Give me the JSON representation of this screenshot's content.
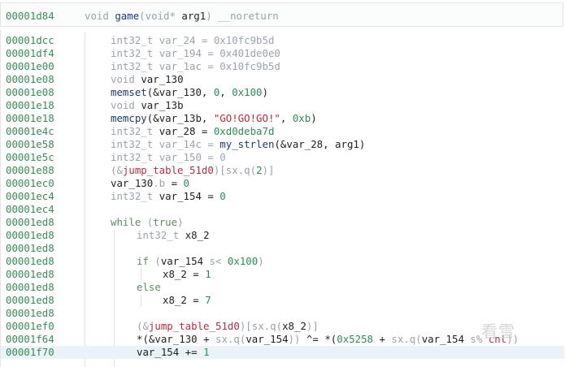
{
  "header": {
    "address": "00001d84",
    "tokens": [
      {
        "t": "void ",
        "c": "type"
      },
      {
        "t": "game",
        "c": "fn"
      },
      {
        "t": "(",
        "c": "sym"
      },
      {
        "t": "void* ",
        "c": "type"
      },
      {
        "t": "arg1",
        "c": "var"
      },
      {
        "t": ") ",
        "c": "sym"
      },
      {
        "t": "__noreturn",
        "c": "type"
      }
    ]
  },
  "lines": [
    {
      "addr": "00001dcc",
      "indent": 1,
      "tokens": [
        {
          "t": "int32_t ",
          "c": "type"
        },
        {
          "t": "var_24",
          "c": "type"
        },
        {
          "t": " = ",
          "c": "type"
        },
        {
          "t": "0x10fc9b5d",
          "c": "type"
        }
      ]
    },
    {
      "addr": "00001df4",
      "indent": 1,
      "tokens": [
        {
          "t": "int32_t ",
          "c": "type"
        },
        {
          "t": "var_194",
          "c": "type"
        },
        {
          "t": " = ",
          "c": "type"
        },
        {
          "t": "0x401de0e0",
          "c": "type"
        }
      ]
    },
    {
      "addr": "00001e00",
      "indent": 1,
      "tokens": [
        {
          "t": "int32_t ",
          "c": "type"
        },
        {
          "t": "var_1ac",
          "c": "type"
        },
        {
          "t": " = ",
          "c": "type"
        },
        {
          "t": "0x10fc9b5d",
          "c": "type"
        }
      ]
    },
    {
      "addr": "00001e08",
      "indent": 1,
      "tokens": [
        {
          "t": "void ",
          "c": "type"
        },
        {
          "t": "var_130",
          "c": "var"
        }
      ]
    },
    {
      "addr": "00001e08",
      "indent": 1,
      "tokens": [
        {
          "t": "memset",
          "c": "fn"
        },
        {
          "t": "(&",
          "c": "dark"
        },
        {
          "t": "var_130",
          "c": "var"
        },
        {
          "t": ", ",
          "c": "dark"
        },
        {
          "t": "0",
          "c": "num"
        },
        {
          "t": ", ",
          "c": "dark"
        },
        {
          "t": "0x100",
          "c": "num"
        },
        {
          "t": ")",
          "c": "dark"
        }
      ]
    },
    {
      "addr": "00001e18",
      "indent": 1,
      "tokens": [
        {
          "t": "void ",
          "c": "type"
        },
        {
          "t": "var_13b",
          "c": "var"
        }
      ]
    },
    {
      "addr": "00001e18",
      "indent": 1,
      "tokens": [
        {
          "t": "memcpy",
          "c": "fn"
        },
        {
          "t": "(&",
          "c": "dark"
        },
        {
          "t": "var_13b",
          "c": "var"
        },
        {
          "t": ", ",
          "c": "dark"
        },
        {
          "t": "\"GO!GO!GO!\"",
          "c": "str"
        },
        {
          "t": ", ",
          "c": "dark"
        },
        {
          "t": "0xb",
          "c": "num"
        },
        {
          "t": ")",
          "c": "dark"
        }
      ]
    },
    {
      "addr": "00001e4c",
      "indent": 1,
      "tokens": [
        {
          "t": "int32_t ",
          "c": "type"
        },
        {
          "t": "var_28",
          "c": "var"
        },
        {
          "t": " = ",
          "c": "dark"
        },
        {
          "t": "0xd0deba7d",
          "c": "num"
        }
      ]
    },
    {
      "addr": "00001e58",
      "indent": 1,
      "tokens": [
        {
          "t": "int32_t ",
          "c": "type"
        },
        {
          "t": "var_14c",
          "c": "type"
        },
        {
          "t": " = ",
          "c": "type"
        },
        {
          "t": "my_strlen",
          "c": "fn"
        },
        {
          "t": "(&",
          "c": "dark"
        },
        {
          "t": "var_28",
          "c": "var"
        },
        {
          "t": ", ",
          "c": "dark"
        },
        {
          "t": "arg1",
          "c": "var"
        },
        {
          "t": ")",
          "c": "dark"
        }
      ]
    },
    {
      "addr": "00001e5c",
      "indent": 1,
      "tokens": [
        {
          "t": "int32_t ",
          "c": "type"
        },
        {
          "t": "var_150",
          "c": "type"
        },
        {
          "t": " = ",
          "c": "type"
        },
        {
          "t": "0",
          "c": "type"
        }
      ]
    },
    {
      "addr": "00001e88",
      "indent": 1,
      "tokens": [
        {
          "t": "(&",
          "c": "sym"
        },
        {
          "t": "jump_table_51d0",
          "c": "jt"
        },
        {
          "t": ")",
          "c": "sym"
        },
        {
          "t": "[",
          "c": "sym"
        },
        {
          "t": "sx.q",
          "c": "mod"
        },
        {
          "t": "(",
          "c": "sym"
        },
        {
          "t": "2",
          "c": "num"
        },
        {
          "t": ")]",
          "c": "sym"
        }
      ]
    },
    {
      "addr": "00001ec0",
      "indent": 1,
      "tokens": [
        {
          "t": "var_130",
          "c": "var"
        },
        {
          "t": ".b",
          "c": "mod"
        },
        {
          "t": " = ",
          "c": "dark"
        },
        {
          "t": "0",
          "c": "num"
        }
      ]
    },
    {
      "addr": "00001ec4",
      "indent": 1,
      "tokens": [
        {
          "t": "int32_t ",
          "c": "type"
        },
        {
          "t": "var_154",
          "c": "var"
        },
        {
          "t": " = ",
          "c": "dark"
        },
        {
          "t": "0",
          "c": "num"
        }
      ]
    },
    {
      "addr": "00001ec4",
      "indent": 1,
      "tokens": []
    },
    {
      "addr": "00001ed8",
      "indent": 1,
      "tokens": [
        {
          "t": "while",
          "c": "kw"
        },
        {
          "t": " (",
          "c": "sym"
        },
        {
          "t": "true",
          "c": "kw"
        },
        {
          "t": ")",
          "c": "sym"
        }
      ]
    },
    {
      "addr": "00001ed8",
      "indent": 2,
      "tokens": [
        {
          "t": "int32_t ",
          "c": "type"
        },
        {
          "t": "x8_2",
          "c": "var"
        }
      ]
    },
    {
      "addr": "00001ed8",
      "indent": 2,
      "tokens": []
    },
    {
      "addr": "00001ed8",
      "indent": 2,
      "tokens": [
        {
          "t": "if",
          "c": "kw"
        },
        {
          "t": " (",
          "c": "sym"
        },
        {
          "t": "var_154",
          "c": "var"
        },
        {
          "t": " s< ",
          "c": "mod"
        },
        {
          "t": "0x100",
          "c": "num"
        },
        {
          "t": ")",
          "c": "sym"
        }
      ]
    },
    {
      "addr": "00001ed8",
      "indent": 3,
      "tokens": [
        {
          "t": "x8_2",
          "c": "var"
        },
        {
          "t": " = ",
          "c": "dark"
        },
        {
          "t": "1",
          "c": "num"
        }
      ]
    },
    {
      "addr": "00001ed8",
      "indent": 2,
      "tokens": [
        {
          "t": "else",
          "c": "kw"
        }
      ]
    },
    {
      "addr": "00001ed8",
      "indent": 3,
      "tokens": [
        {
          "t": "x8_2",
          "c": "var"
        },
        {
          "t": " = ",
          "c": "dark"
        },
        {
          "t": "7",
          "c": "num"
        }
      ]
    },
    {
      "addr": "00001ed8",
      "indent": 2,
      "tokens": []
    },
    {
      "addr": "00001ef0",
      "indent": 2,
      "tokens": [
        {
          "t": "(&",
          "c": "sym"
        },
        {
          "t": "jump_table_51d0",
          "c": "jt"
        },
        {
          "t": ")",
          "c": "sym"
        },
        {
          "t": "[",
          "c": "sym"
        },
        {
          "t": "sx.q",
          "c": "mod"
        },
        {
          "t": "(",
          "c": "sym"
        },
        {
          "t": "x8_2",
          "c": "var"
        },
        {
          "t": ")]",
          "c": "sym"
        }
      ]
    },
    {
      "addr": "00001f64",
      "indent": 2,
      "tokens": [
        {
          "t": "*(&",
          "c": "dark"
        },
        {
          "t": "var_130",
          "c": "var"
        },
        {
          "t": " + ",
          "c": "dark"
        },
        {
          "t": "sx.q",
          "c": "mod"
        },
        {
          "t": "(",
          "c": "sym"
        },
        {
          "t": "var_154",
          "c": "var"
        },
        {
          "t": ")) ",
          "c": "sym"
        },
        {
          "t": "^= ",
          "c": "dark"
        },
        {
          "t": "*(",
          "c": "dark"
        },
        {
          "t": "0x5258",
          "c": "num"
        },
        {
          "t": " + ",
          "c": "dark"
        },
        {
          "t": "sx.q",
          "c": "mod"
        },
        {
          "t": "(",
          "c": "sym"
        },
        {
          "t": "var_154",
          "c": "var"
        },
        {
          "t": " s% ",
          "c": "mod"
        },
        {
          "t": "cnt",
          "c": "jt"
        },
        {
          "t": "))",
          "c": "sym"
        }
      ]
    },
    {
      "addr": "00001f70",
      "indent": 2,
      "highlight": true,
      "tokens": [
        {
          "t": "var_154",
          "c": "var"
        },
        {
          "t": " += ",
          "c": "dark"
        },
        {
          "t": "1",
          "c": "num"
        }
      ]
    }
  ],
  "watermark": "看雪"
}
